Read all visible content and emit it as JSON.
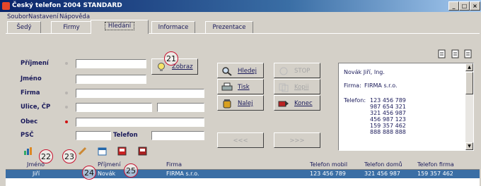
{
  "window": {
    "title": "Český telefon 2004 STANDARD"
  },
  "menu": [
    "Soubor",
    "Nastavení",
    "Nápověda"
  ],
  "tabs": [
    {
      "label": "Šedý"
    },
    {
      "label": "Firmy"
    },
    {
      "label": "Hledání"
    },
    {
      "label": "Informace"
    },
    {
      "label": "Prezentace"
    }
  ],
  "form": {
    "surname_label": "Příjmení",
    "name_label": "Jméno",
    "firm_label": "Firma",
    "street_label": "Ulice, ČP",
    "town_label": "Obec",
    "psc_label": "PSČ",
    "phone_label": "Telefon"
  },
  "buttons": {
    "zobraz": "Zobraz",
    "hledej": "Hledej",
    "tisk": "Tisk",
    "nalej": "Nalej",
    "stop": "STOP",
    "kopii": "Kopii",
    "konec": "Konec",
    "prev": "<<<",
    "next": ">>>"
  },
  "result": {
    "name": "Novák Jiří, Ing.",
    "firm_label": "Firma:",
    "firm": "FIRMA s.r.o.",
    "phone_label": "Telefon:",
    "phones": [
      "123 456 789",
      "987 654 321",
      "321 456 987",
      "456 987 123",
      "159 357 462",
      "888 888 888"
    ]
  },
  "table": {
    "headers": [
      "Jméno",
      "Příjmení",
      "Firma",
      "Telefon mobil",
      "Telefon domů",
      "Telefon firma"
    ],
    "rows": [
      [
        "Jiří",
        "Novák",
        "FIRMA s.r.o.",
        "123 456 789",
        "321 456 987",
        "159 357 462"
      ]
    ]
  },
  "callouts": [
    "21",
    "22",
    "23",
    "24",
    "25"
  ],
  "colors": {
    "accent": "#0a246a",
    "required": "#d01010",
    "selection": "#3a6ea5"
  }
}
